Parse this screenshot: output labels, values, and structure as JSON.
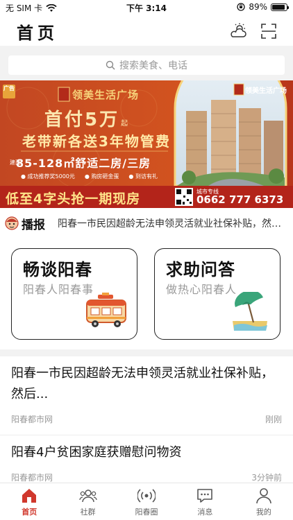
{
  "status_bar": {
    "carrier": "无 SIM 卡",
    "time": "下午 3:14",
    "battery": "89%",
    "battery_level": 0.89
  },
  "header": {
    "title": "首页",
    "weather_icon": "weather-cloud-sun-icon",
    "scan_icon": "scan-icon"
  },
  "search": {
    "placeholder": "搜索美食、电话"
  },
  "banner": {
    "tag": "广告",
    "brand": "领美生活广场",
    "brand_small": "领美生活广场",
    "headline": "首付5万",
    "headline_suffix": "起",
    "subline": "老带新各送3年物管费",
    "size_text": "85-128㎡舒适二房/三房",
    "size_prefix": "建面",
    "perks": [
      "● 成功推荐奖5000元",
      "● 购房砸金蛋",
      "● 到访有礼"
    ],
    "bottom_slogan": "低至4字头抢一期现房",
    "hotline_label": "城市专线",
    "hotline": "0662 777 6373",
    "accent_color": "#c8421f",
    "gold_color": "#f6d27a"
  },
  "broadcast": {
    "label": "播报",
    "text": "阳春一市民因超龄无法申领灵活就业社保补贴，然后…"
  },
  "cards": [
    {
      "title": "畅谈阳春",
      "subtitle": "阳春人阳春事",
      "icon": "rv-camper-icon"
    },
    {
      "title": "求助问答",
      "subtitle": "做热心阳春人",
      "icon": "beach-umbrella-icon"
    }
  ],
  "news": [
    {
      "title": "阳春一市民因超龄无法申领灵活就业社保补贴，然后...",
      "source": "阳春都市网",
      "time": "刚刚"
    },
    {
      "title": "阳春4户贫困家庭获赠慰问物资",
      "source": "阳春都市网",
      "time": "3分钟前"
    }
  ],
  "tabbar": [
    {
      "label": "首页",
      "icon": "home-icon",
      "active": true
    },
    {
      "label": "社群",
      "icon": "community-icon",
      "active": false
    },
    {
      "label": "阳春圈",
      "icon": "radio-circle-icon",
      "active": false
    },
    {
      "label": "消息",
      "icon": "message-icon",
      "active": false
    },
    {
      "label": "我的",
      "icon": "profile-icon",
      "active": false
    }
  ],
  "colors": {
    "brand_red": "#d0382d",
    "page_gray": "#f2f2f2"
  }
}
